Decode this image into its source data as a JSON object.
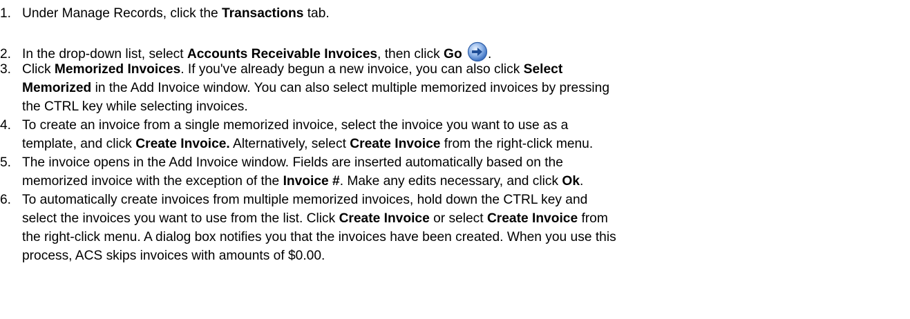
{
  "steps": [
    {
      "num": "1.",
      "lines": [
        [
          "Under Manage Records, click the ",
          {
            "b": "Transactions"
          },
          " tab."
        ]
      ]
    },
    {
      "num": "2.",
      "lines": [
        [
          "In the drop-down list, select ",
          {
            "b": "Accounts Receivable Invoices"
          },
          ", then click ",
          {
            "b": "Go"
          },
          {
            "icon": "go-arrow-icon"
          },
          "."
        ]
      ]
    },
    {
      "num": "3.",
      "lines": [
        [
          "Click ",
          {
            "b": "Memorized Invoices"
          },
          ". If you've already begun a new invoice, you can also click ",
          {
            "b": "Select"
          }
        ],
        [
          {
            "b": "Memorized"
          },
          " in the Add Invoice window. You can also select multiple memorized invoices by pressing"
        ],
        [
          "the CTRL key while selecting invoices."
        ]
      ]
    },
    {
      "num": "4.",
      "lines": [
        [
          "To create an invoice from a single memorized invoice, select the invoice you want to use as a"
        ],
        [
          "template, and click ",
          {
            "b": "Create Invoice."
          },
          " Alternatively, select ",
          {
            "b": "Create Invoice"
          },
          " from the right-click menu."
        ]
      ]
    },
    {
      "num": "5.",
      "lines": [
        [
          "The invoice opens in the Add Invoice window. Fields are inserted automatically based on the"
        ],
        [
          "memorized invoice with the exception of the ",
          {
            "b": "Invoice #"
          },
          ". Make any edits necessary, and click ",
          {
            "b": "Ok"
          },
          "."
        ]
      ]
    },
    {
      "num": "6.",
      "lines": [
        [
          "To automatically create invoices from multiple memorized invoices, hold down the CTRL key and"
        ],
        [
          "select the invoices you want to use from the list. Click ",
          {
            "b": "Create Invoice"
          },
          " or select ",
          {
            "b": "Create Invoice"
          },
          " from"
        ],
        [
          "the right-click menu. A dialog box notifies you that the invoices have been created. When you use this"
        ],
        [
          "process, ACS skips invoices with amounts of $0.00."
        ]
      ]
    }
  ]
}
